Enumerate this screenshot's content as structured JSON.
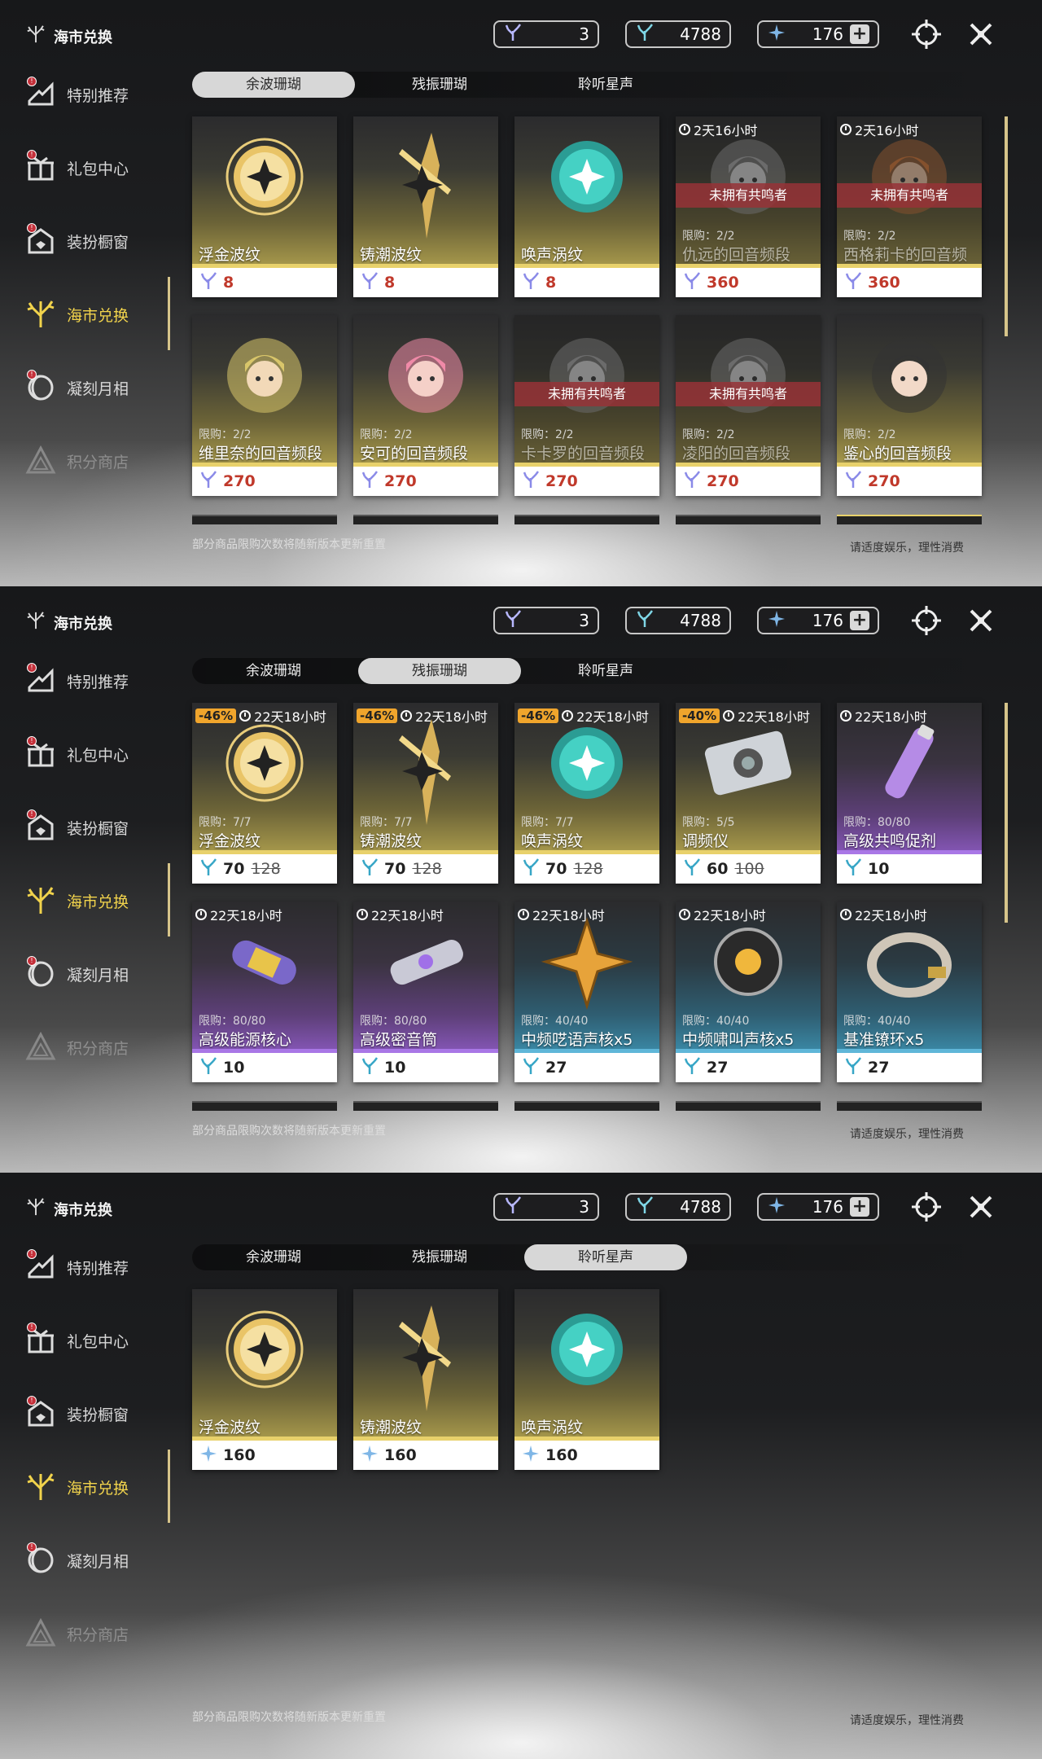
{
  "app_title": "海市兑换",
  "sidebar": {
    "items": [
      {
        "label": "特别推荐"
      },
      {
        "label": "礼包中心"
      },
      {
        "label": "装扮橱窗"
      },
      {
        "label": "海市兑换"
      },
      {
        "label": "凝刻月相"
      },
      {
        "label": "积分商店"
      }
    ]
  },
  "currencies": [
    {
      "name": "coral-1",
      "value": "3"
    },
    {
      "name": "coral-2",
      "value": "4788"
    },
    {
      "name": "star",
      "value": "176"
    }
  ],
  "tabs": [
    "余波珊瑚",
    "残振珊瑚",
    "聆听星声"
  ],
  "footer": {
    "left": "部分商品限购次数将随新版本更新重置",
    "right": "请适度娱乐，理性消费"
  },
  "panels": [
    {
      "active_tab": 0,
      "cards": [
        {
          "name": "浮金波纹",
          "price": "8",
          "limit": "",
          "timer": "",
          "discount": "",
          "unowned": "",
          "color": "gold"
        },
        {
          "name": "铸潮波纹",
          "price": "8",
          "limit": "",
          "timer": "",
          "discount": "",
          "unowned": "",
          "color": "gold"
        },
        {
          "name": "唤声涡纹",
          "price": "8",
          "limit": "",
          "timer": "",
          "discount": "",
          "unowned": "",
          "color": "gold"
        },
        {
          "name": "仇远的回音频段",
          "price": "360",
          "limit": "限购：2/2",
          "timer": "2天16小时",
          "discount": "",
          "unowned": "未拥有共鸣者",
          "color": "gold"
        },
        {
          "name": "西格莉卡的回音频段",
          "price": "360",
          "limit": "限购：2/2",
          "timer": "2天16小时",
          "discount": "",
          "unowned": "未拥有共鸣者",
          "color": "gold"
        },
        {
          "name": "维里奈的回音频段",
          "price": "270",
          "limit": "限购：2/2",
          "timer": "",
          "discount": "",
          "unowned": "",
          "color": "gold"
        },
        {
          "name": "安可的回音频段",
          "price": "270",
          "limit": "限购：2/2",
          "timer": "",
          "discount": "",
          "unowned": "",
          "color": "gold"
        },
        {
          "name": "卡卡罗的回音频段",
          "price": "270",
          "limit": "限购：2/2",
          "timer": "",
          "discount": "",
          "unowned": "未拥有共鸣者",
          "color": "gold"
        },
        {
          "name": "凌阳的回音频段",
          "price": "270",
          "limit": "限购：2/2",
          "timer": "",
          "discount": "",
          "unowned": "未拥有共鸣者",
          "color": "gold"
        },
        {
          "name": "鉴心的回音频段",
          "price": "270",
          "limit": "限购：2/2",
          "timer": "",
          "discount": "",
          "unowned": "",
          "color": "gold"
        }
      ]
    },
    {
      "active_tab": 1,
      "cards": [
        {
          "name": "浮金波纹",
          "price": "70",
          "old_price": "128",
          "limit": "限购：7/7",
          "timer": "22天18小时",
          "discount": "-46%",
          "color": "gold"
        },
        {
          "name": "铸潮波纹",
          "price": "70",
          "old_price": "128",
          "limit": "限购：7/7",
          "timer": "22天18小时",
          "discount": "-46%",
          "color": "gold"
        },
        {
          "name": "唤声涡纹",
          "price": "70",
          "old_price": "128",
          "limit": "限购：7/7",
          "timer": "22天18小时",
          "discount": "-46%",
          "color": "gold"
        },
        {
          "name": "调频仪",
          "price": "60",
          "old_price": "100",
          "limit": "限购：5/5",
          "timer": "22天18小时",
          "discount": "-40%",
          "color": "gold"
        },
        {
          "name": "高级共鸣促剂",
          "price": "10",
          "old_price": "",
          "limit": "限购：80/80",
          "timer": "22天18小时",
          "discount": "",
          "color": "purple"
        },
        {
          "name": "高级能源核心",
          "price": "10",
          "old_price": "",
          "limit": "限购：80/80",
          "timer": "22天18小时",
          "discount": "",
          "color": "purple"
        },
        {
          "name": "高级密音筒",
          "price": "10",
          "old_price": "",
          "limit": "限购：80/80",
          "timer": "22天18小时",
          "discount": "",
          "color": "purple"
        },
        {
          "name": "中频呓语声核x5",
          "price": "27",
          "old_price": "",
          "limit": "限购：40/40",
          "timer": "22天18小时",
          "discount": "",
          "color": "blue"
        },
        {
          "name": "中频啸叫声核x5",
          "price": "27",
          "old_price": "",
          "limit": "限购：40/40",
          "timer": "22天18小时",
          "discount": "",
          "color": "blue"
        },
        {
          "name": "基准镣环x5",
          "price": "27",
          "old_price": "",
          "limit": "限购：40/40",
          "timer": "22天18小时",
          "discount": "",
          "color": "blue"
        }
      ]
    },
    {
      "active_tab": 2,
      "cards": [
        {
          "name": "浮金波纹",
          "price": "160",
          "color": "gold"
        },
        {
          "name": "铸潮波纹",
          "price": "160",
          "color": "gold"
        },
        {
          "name": "唤声涡纹",
          "price": "160",
          "color": "gold"
        }
      ]
    }
  ]
}
